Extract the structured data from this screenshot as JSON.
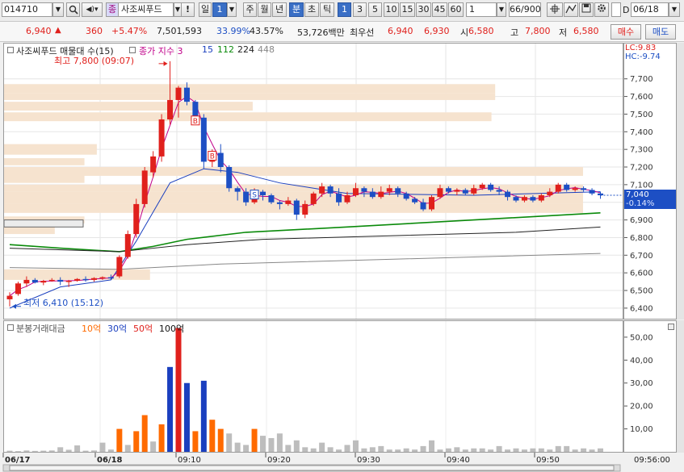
{
  "toolbar": {
    "code": "014710",
    "name": "사조씨푸드",
    "name_tag": "종",
    "alert": "!",
    "tabs": [
      "일",
      "1",
      "주",
      "월",
      "년",
      "분",
      "초",
      "틱"
    ],
    "intervals": [
      "1",
      "3",
      "5",
      "10",
      "15",
      "30",
      "45",
      "60"
    ],
    "custom_interval": "1",
    "count": "66/900",
    "date_check_label": "D",
    "date": "06/18"
  },
  "quote": {
    "price": "6,940",
    "change": "360",
    "change_pct": "+5.47%",
    "volume": "7,501,593",
    "ratio1": "33.99%",
    "ratio2": "43.57%",
    "amount": "53,726백만",
    "best_label": "최우선",
    "ask": "6,940",
    "bid": "6,930",
    "open_label": "시",
    "open": "6,580",
    "high_label": "고",
    "high": "7,800",
    "low_label": "저",
    "low": "6,580",
    "buy": "매수",
    "sell": "매도"
  },
  "price_legend": {
    "title": "사조씨푸드 매물대 수(15)",
    "ma_label": "종가 지수 3",
    "ma_periods": [
      "15",
      "112",
      "224",
      "448"
    ],
    "ma_colors": [
      "#c0008a",
      "#1a3fbf",
      "#0a8a0a",
      "#222222",
      "#888888"
    ],
    "lc": "LC:9.83",
    "hc": "HC:-9.74"
  },
  "annotations": {
    "high": "최고 7,800 (09:07)",
    "low": "최저 6,410 (15:12)",
    "current_price": "7,040",
    "current_change": "-0.14%",
    "signal_markers": [
      "B",
      "B",
      "S"
    ]
  },
  "volume_legend": {
    "title": "분봉거래대금",
    "levels": [
      {
        "label": "10억",
        "color": "#ff6a00"
      },
      {
        "label": "30억",
        "color": "#1a3fbf"
      },
      {
        "label": "50억",
        "color": "#e0201c"
      },
      {
        "label": "100억",
        "color": "#111111"
      }
    ]
  },
  "chart_data": [
    {
      "type": "candlestick",
      "title": "사조씨푸드 매물대 수(15)",
      "y_axis": {
        "ylim": [
          6340,
          7900
        ],
        "ticks": [
          6400,
          6500,
          6600,
          6700,
          6800,
          6900,
          7000,
          7100,
          7200,
          7300,
          7400,
          7500,
          7600,
          7700
        ],
        "tick_labels": [
          "6,400",
          "6,500",
          "6,600",
          "6,700",
          "6,800",
          "6,900",
          "7,000",
          "7,100",
          "7,200",
          "7,300",
          "7,400",
          "7,500",
          "7,600",
          "7,700"
        ]
      },
      "x_axis_labels": [
        "06/17",
        "06/18",
        "09:10",
        "09:20",
        "09:30",
        "09:40",
        "09:50",
        "09:56:00"
      ],
      "candles": [
        [
          6450,
          6490,
          6410,
          6470
        ],
        [
          6480,
          6550,
          6470,
          6540
        ],
        [
          6540,
          6580,
          6520,
          6560
        ],
        [
          6560,
          6570,
          6540,
          6545
        ],
        [
          6545,
          6560,
          6530,
          6555
        ],
        [
          6555,
          6570,
          6550,
          6560
        ],
        [
          6560,
          6575,
          6530,
          6550
        ],
        [
          6550,
          6560,
          6520,
          6555
        ],
        [
          6555,
          6570,
          6550,
          6565
        ],
        [
          6565,
          6580,
          6550,
          6560
        ],
        [
          6560,
          6575,
          6550,
          6570
        ],
        [
          6570,
          6580,
          6560,
          6575
        ],
        [
          6575,
          6590,
          6560,
          6570
        ],
        [
          6580,
          6700,
          6570,
          6690
        ],
        [
          6690,
          6840,
          6680,
          6820
        ],
        [
          6820,
          7020,
          6800,
          6990
        ],
        [
          6990,
          7200,
          6970,
          7180
        ],
        [
          7170,
          7290,
          7140,
          7260
        ],
        [
          7260,
          7500,
          7230,
          7470
        ],
        [
          7470,
          7800,
          7440,
          7580
        ],
        [
          7580,
          7660,
          7480,
          7650
        ],
        [
          7650,
          7680,
          7550,
          7570
        ],
        [
          7570,
          7580,
          7460,
          7480
        ],
        [
          7480,
          7500,
          7190,
          7230
        ],
        [
          7230,
          7300,
          7200,
          7280
        ],
        [
          7280,
          7330,
          7170,
          7200
        ],
        [
          7200,
          7210,
          7060,
          7080
        ],
        [
          7080,
          7090,
          7010,
          7060
        ],
        [
          7060,
          7080,
          6980,
          7000
        ],
        [
          7000,
          7080,
          6990,
          7060
        ],
        [
          7060,
          7070,
          7010,
          7040
        ],
        [
          7040,
          7050,
          6990,
          7000
        ],
        [
          7000,
          7010,
          6960,
          6990
        ],
        [
          6990,
          7030,
          6980,
          7010
        ],
        [
          7010,
          7020,
          6900,
          6930
        ],
        [
          6930,
          7010,
          6910,
          6990
        ],
        [
          6990,
          7060,
          6980,
          7050
        ],
        [
          7050,
          7110,
          7030,
          7090
        ],
        [
          7090,
          7100,
          7030,
          7050
        ],
        [
          7050,
          7080,
          6980,
          7000
        ],
        [
          7000,
          7060,
          6990,
          7040
        ],
        [
          7040,
          7110,
          7030,
          7080
        ],
        [
          7080,
          7090,
          7030,
          7060
        ],
        [
          7060,
          7080,
          7020,
          7030
        ],
        [
          7030,
          7090,
          7020,
          7060
        ],
        [
          7060,
          7100,
          7040,
          7080
        ],
        [
          7080,
          7090,
          7030,
          7050
        ],
        [
          7050,
          7060,
          7010,
          7020
        ],
        [
          7020,
          7030,
          6990,
          7000
        ],
        [
          7000,
          7020,
          6950,
          6960
        ],
        [
          6960,
          7040,
          6950,
          7030
        ],
        [
          7030,
          7100,
          7020,
          7080
        ],
        [
          7080,
          7090,
          7050,
          7060
        ],
        [
          7060,
          7080,
          7040,
          7070
        ],
        [
          7070,
          7080,
          7040,
          7050
        ],
        [
          7050,
          7100,
          7040,
          7080
        ],
        [
          7080,
          7110,
          7070,
          7100
        ],
        [
          7100,
          7110,
          7060,
          7070
        ],
        [
          7070,
          7090,
          7040,
          7060
        ],
        [
          7060,
          7070,
          7010,
          7030
        ],
        [
          7030,
          7040,
          7000,
          7010
        ],
        [
          7010,
          7040,
          7000,
          7030
        ],
        [
          7030,
          7040,
          7000,
          7010
        ],
        [
          7010,
          7050,
          7000,
          7040
        ],
        [
          7040,
          7080,
          7030,
          7060
        ],
        [
          7060,
          7110,
          7050,
          7100
        ],
        [
          7100,
          7110,
          7060,
          7070
        ],
        [
          7070,
          7090,
          7060,
          7080
        ],
        [
          7080,
          7090,
          7060,
          7070
        ],
        [
          7070,
          7080,
          7040,
          7050
        ],
        [
          7050,
          7060,
          7020,
          7040
        ]
      ],
      "ma_series": [
        {
          "name": "15",
          "color": "#1a3fbf",
          "points": [
            [
              0,
              6400
            ],
            [
              6,
              6520
            ],
            [
              12,
              6560
            ],
            [
              15,
              6780
            ],
            [
              19,
              7110
            ],
            [
              23,
              7190
            ],
            [
              27,
              7170
            ],
            [
              32,
              7110
            ],
            [
              40,
              7050
            ],
            [
              55,
              7040
            ],
            [
              70,
              7060
            ]
          ]
        },
        {
          "name": "112",
          "color": "#0a8a0a",
          "points": [
            [
              0,
              6760
            ],
            [
              6,
              6740
            ],
            [
              13,
              6720
            ],
            [
              17,
              6750
            ],
            [
              21,
              6790
            ],
            [
              28,
              6830
            ],
            [
              40,
              6860
            ],
            [
              55,
              6900
            ],
            [
              70,
              6940
            ]
          ]
        },
        {
          "name": "224",
          "color": "#222222",
          "points": [
            [
              0,
              6740
            ],
            [
              13,
              6720
            ],
            [
              21,
              6760
            ],
            [
              30,
              6790
            ],
            [
              45,
              6810
            ],
            [
              60,
              6830
            ],
            [
              70,
              6860
            ]
          ]
        },
        {
          "name": "448",
          "color": "#888888",
          "points": [
            [
              0,
              6630
            ],
            [
              13,
              6620
            ],
            [
              25,
              6650
            ],
            [
              40,
              6670
            ],
            [
              55,
              6690
            ],
            [
              70,
              6710
            ]
          ]
        }
      ],
      "volume_profile": [
        {
          "price_low": 6560,
          "price_high": 6620,
          "length": 0.236
        },
        {
          "price_low": 6820,
          "price_high": 6860,
          "length": 0.082
        },
        {
          "price_low": 6880,
          "price_high": 6920,
          "length": 0.13
        },
        {
          "price_low": 6940,
          "price_high": 6990,
          "length": 0.936
        },
        {
          "price_low": 6990,
          "price_high": 7060,
          "length": 0.936
        },
        {
          "price_low": 7060,
          "price_high": 7100,
          "length": 0.936
        },
        {
          "price_low": 7110,
          "price_high": 7160,
          "length": 0.13
        },
        {
          "price_low": 7150,
          "price_high": 7200,
          "length": 0.936
        },
        {
          "price_low": 7210,
          "price_high": 7250,
          "length": 0.13
        },
        {
          "price_low": 7270,
          "price_high": 7330,
          "length": 0.15
        },
        {
          "price_low": 7460,
          "price_high": 7510,
          "length": 0.788
        },
        {
          "price_low": 7520,
          "price_high": 7570,
          "length": 0.402
        },
        {
          "price_low": 7580,
          "price_high": 7620,
          "length": 0.794
        },
        {
          "price_low": 7620,
          "price_high": 7670,
          "length": 0.794
        }
      ],
      "signals": [
        {
          "index": 22,
          "label": "B"
        },
        {
          "index": 24,
          "label": "B"
        },
        {
          "index": 29,
          "label": "S"
        }
      ]
    },
    {
      "type": "bar",
      "title": "분봉거래대금",
      "y_axis": {
        "ylim": [
          0,
          57
        ],
        "ticks": [
          10,
          20,
          30,
          40,
          50
        ],
        "tick_labels": [
          "10,00",
          "20,00",
          "30,00",
          "40,00",
          "50,00"
        ]
      },
      "values": [
        0.5,
        0.3,
        0.6,
        0.4,
        0.5,
        0.6,
        2.0,
        0.9,
        2.8,
        0.5,
        0.6,
        4.0,
        1.0,
        10.0,
        3.0,
        9.0,
        16.0,
        4.5,
        12.0,
        37.0,
        54.0,
        30.0,
        9.0,
        31.0,
        14.0,
        10.0,
        8.0,
        4.0,
        3.0,
        10.0,
        7.0,
        6.0,
        8.0,
        3.0,
        5.0,
        2.0,
        1.5,
        4.0,
        2.0,
        1.0,
        3.0,
        5.0,
        1.5,
        2.0,
        2.5,
        1.0,
        1.0,
        1.5,
        1.0,
        2.5,
        5.0,
        1.0,
        1.5,
        2.0,
        1.0,
        1.5,
        1.5,
        1.0,
        2.5,
        1.0,
        1.5,
        1.0,
        1.5,
        1.5,
        1.0,
        2.5,
        2.5,
        1.0,
        1.5,
        1.0,
        1.5
      ],
      "colors": [
        "#bdbdbd",
        "#bdbdbd",
        "#bdbdbd",
        "#bdbdbd",
        "#bdbdbd",
        "#bdbdbd",
        "#bdbdbd",
        "#bdbdbd",
        "#bdbdbd",
        "#bdbdbd",
        "#bdbdbd",
        "#bdbdbd",
        "#bdbdbd",
        "#ff6a00",
        "#bdbdbd",
        "#ff6a00",
        "#ff6a00",
        "#bdbdbd",
        "#ff6a00",
        "#1a3fbf",
        "#e0201c",
        "#1a3fbf",
        "#ff6a00",
        "#1a3fbf",
        "#ff6a00",
        "#ff6a00",
        "#bdbdbd",
        "#bdbdbd",
        "#bdbdbd",
        "#ff6a00",
        "#bdbdbd",
        "#bdbdbd",
        "#bdbdbd",
        "#bdbdbd",
        "#bdbdbd",
        "#bdbdbd",
        "#bdbdbd",
        "#bdbdbd",
        "#bdbdbd",
        "#bdbdbd",
        "#bdbdbd",
        "#bdbdbd",
        "#bdbdbd",
        "#bdbdbd",
        "#bdbdbd",
        "#bdbdbd",
        "#bdbdbd",
        "#bdbdbd",
        "#bdbdbd",
        "#bdbdbd",
        "#bdbdbd",
        "#bdbdbd",
        "#bdbdbd",
        "#bdbdbd",
        "#bdbdbd",
        "#bdbdbd",
        "#bdbdbd",
        "#bdbdbd",
        "#bdbdbd",
        "#bdbdbd",
        "#bdbdbd",
        "#bdbdbd",
        "#bdbdbd",
        "#bdbdbd",
        "#bdbdbd",
        "#bdbdbd",
        "#bdbdbd",
        "#bdbdbd",
        "#bdbdbd",
        "#bdbdbd",
        "#bdbdbd"
      ]
    }
  ],
  "colors": {
    "up": "#e0201c",
    "down": "#1d4fc4",
    "profile": "#f6e3cf"
  }
}
